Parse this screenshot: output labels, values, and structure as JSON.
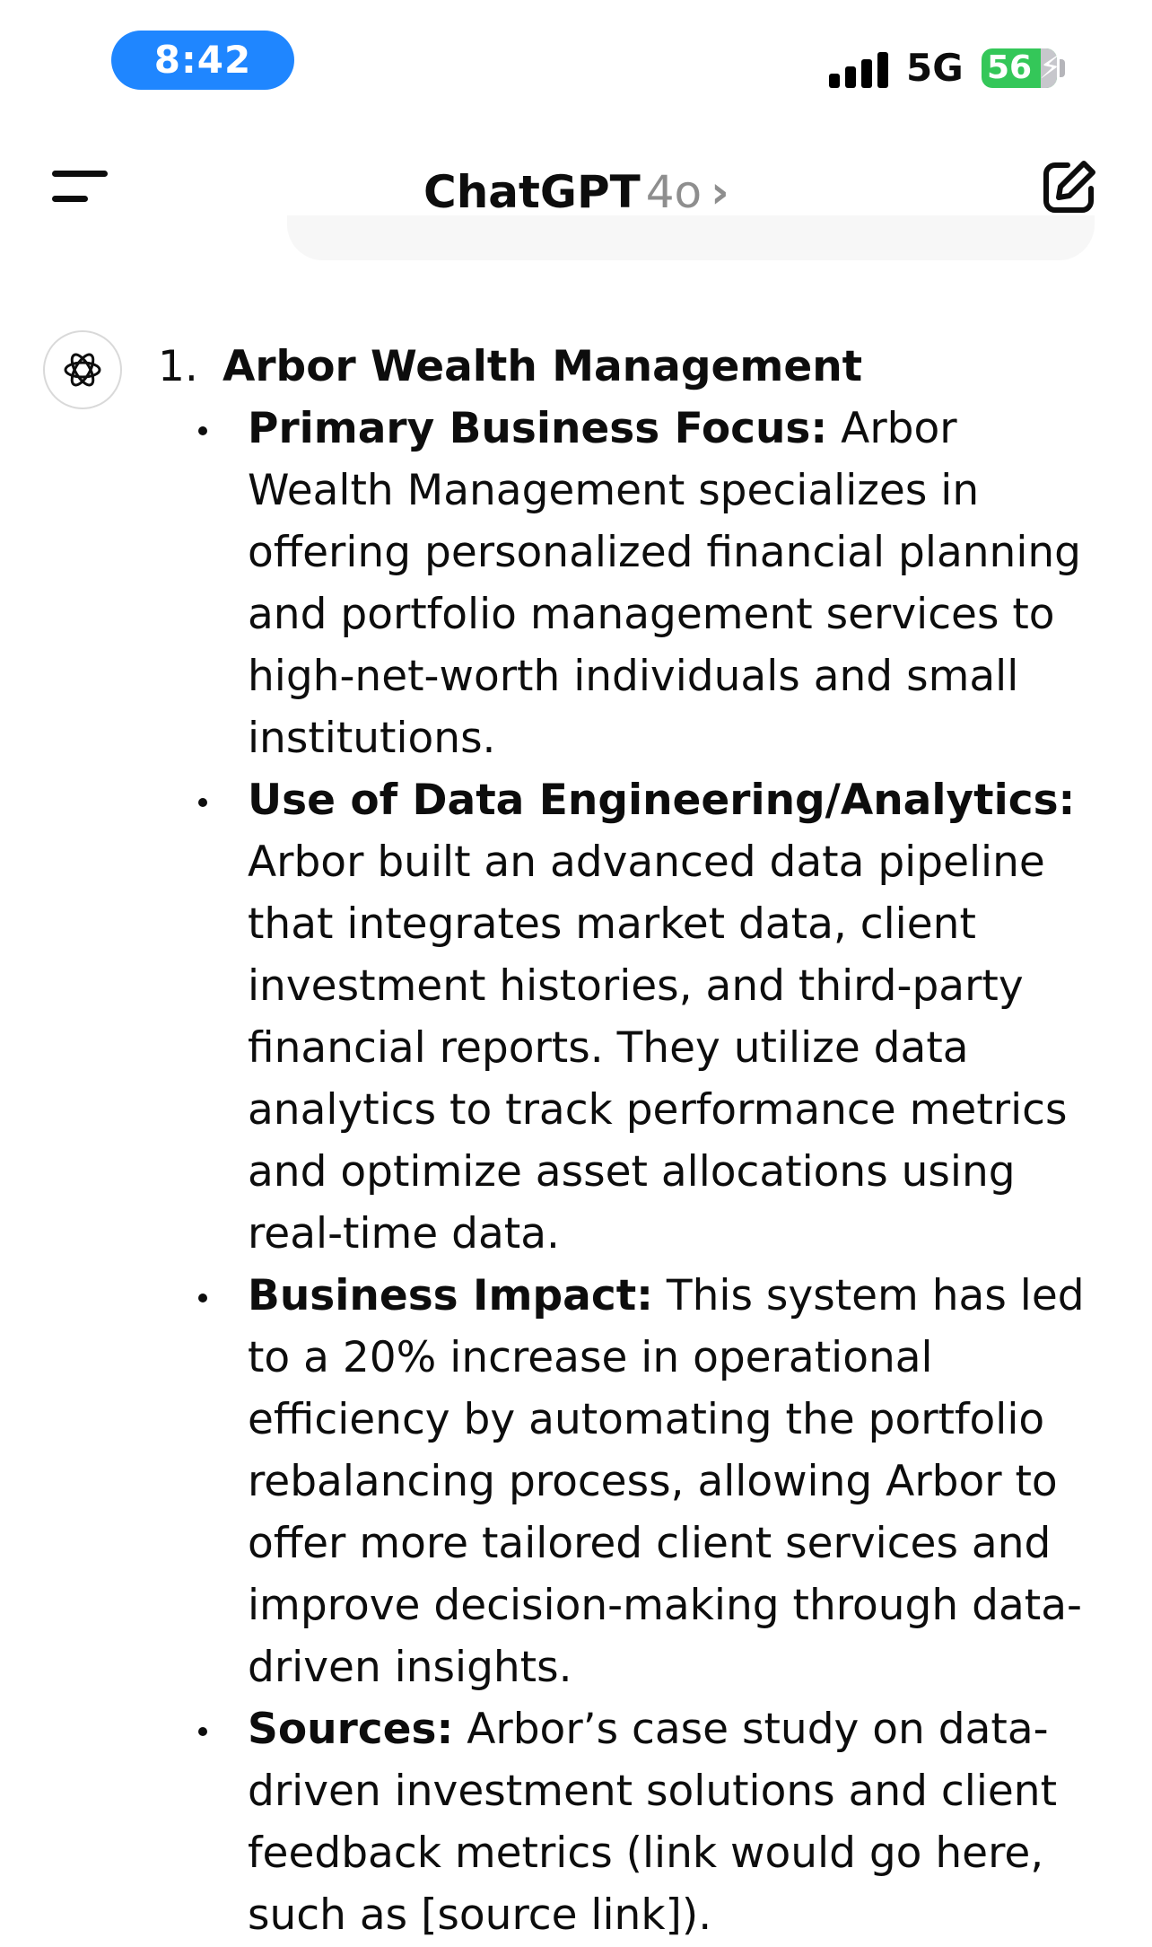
{
  "status_bar": {
    "time": "8:42",
    "network": "5G",
    "battery": "56",
    "colors": {
      "time_pill": "#1f86ff",
      "battery": "#34c759"
    }
  },
  "header": {
    "app_name": "ChatGPT",
    "model": "4o",
    "chevron": "›",
    "icons": {
      "menu": "menu-icon",
      "new_chat": "edit-icon"
    }
  },
  "message": {
    "avatar_icon": "openai-logo-icon",
    "items": [
      {
        "number": "1.",
        "title": "Arbor Wealth Management",
        "bullets": [
          {
            "label": "Primary Business Focus:",
            "text": "Arbor Wealth Management specializes in offering personalized financial planning and portfolio management services to high-net-worth individuals and small institutions."
          },
          {
            "label": "Use of Data Engineering/Analytics:",
            "text": "Arbor built an advanced data pipeline that integrates market data, client investment histories, and third-party financial reports. They utilize data analytics to track performance metrics and optimize asset allocations using real-time data."
          },
          {
            "label": "Business Impact:",
            "text": "This system has led to a 20% increase in operational efficiency by automating the portfolio rebalancing process, allowing Arbor to offer more tailored client services and improve decision-making through data-driven insights."
          },
          {
            "label": "Sources:",
            "text": "Arbor’s case study on data-driven investment solutions and client feedback metrics (link would go here, such as [source link])."
          }
        ]
      }
    ]
  }
}
